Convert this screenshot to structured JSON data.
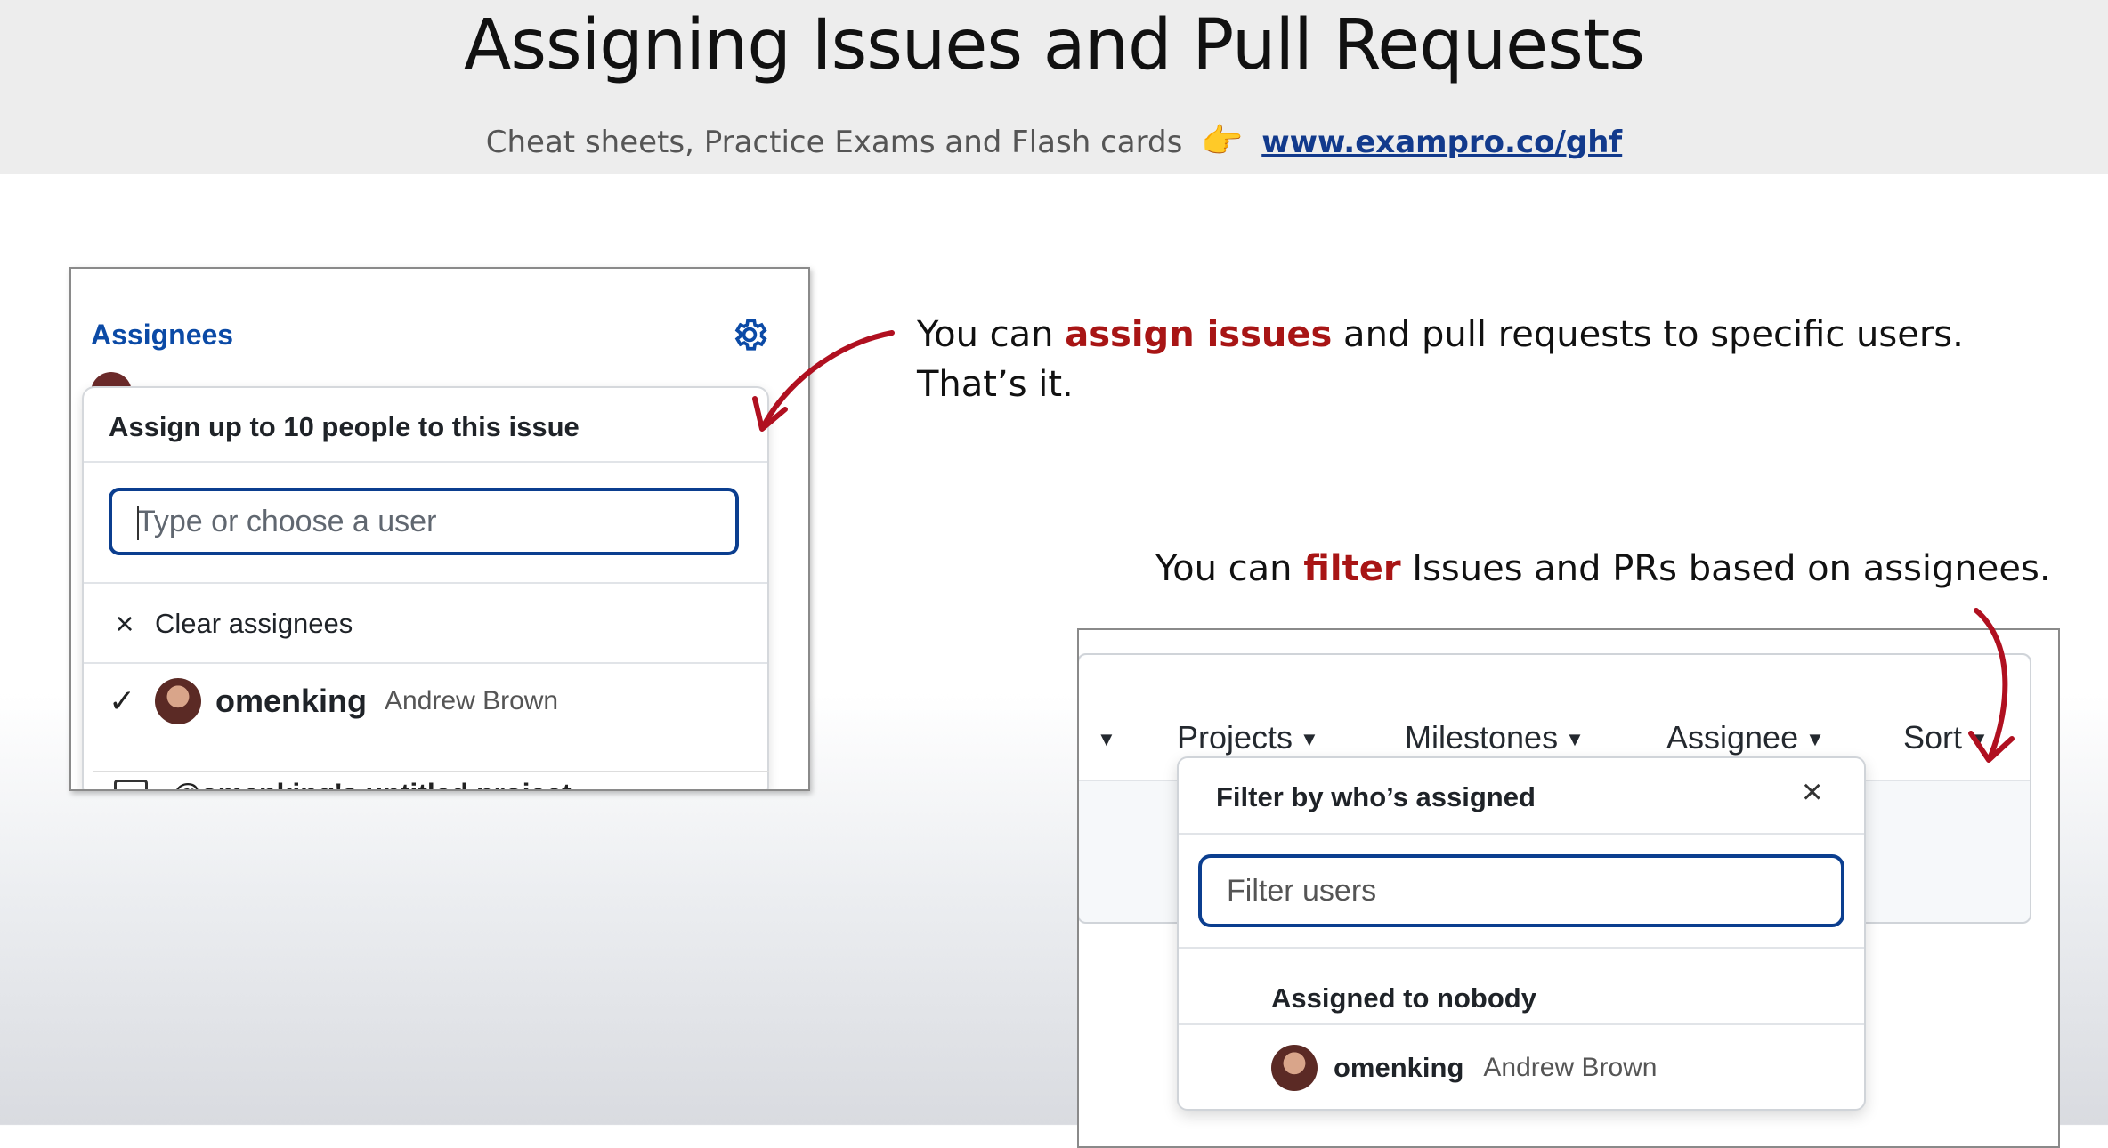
{
  "header": {
    "title": "Assigning Issues and Pull Requests",
    "subtitle": "Cheat sheets, Practice Exams and Flash cards",
    "link": "www.exampro.co/ghf",
    "pointer_emoji": "👉"
  },
  "left_panel": {
    "section_label": "Assignees",
    "popup_title": "Assign up to 10 people to this issue",
    "input_placeholder": "Type or choose a user",
    "clear_label": "Clear assignees",
    "clear_icon": "×",
    "check_icon": "✓",
    "user": {
      "username": "omenking",
      "fullname": "Andrew Brown"
    },
    "project_row_text": "@omenking's untitled project"
  },
  "annotations": {
    "note1_pre": "You can ",
    "note1_hl": "assign issues",
    "note1_post": " and pull requests to specific users.",
    "note1_line2": "That’s it.",
    "note2_pre": "You can ",
    "note2_hl": "filter",
    "note2_post": " Issues and PRs based on assignees."
  },
  "right_panel": {
    "nav": [
      "Projects",
      "Milestones",
      "Assignee",
      "Sort"
    ],
    "dropdown_title": "Filter by who’s assigned",
    "close_icon": "×",
    "filter_placeholder": "Filter users",
    "nobody_label": "Assigned to nobody",
    "user": {
      "username": "omenking",
      "fullname": "Andrew Brown"
    }
  },
  "colors": {
    "accent_blue": "#0b3e8f",
    "highlight_red": "#a81515",
    "link_blue": "#0b4aa6"
  }
}
